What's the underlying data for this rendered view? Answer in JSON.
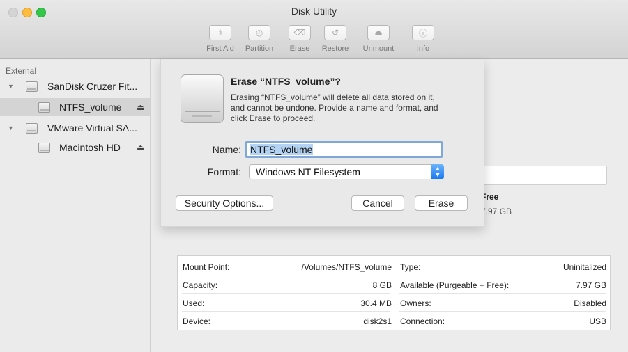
{
  "window": {
    "title": "Disk Utility"
  },
  "toolbar": [
    {
      "label": "First Aid",
      "icon": "stethoscope-icon",
      "glyph": "⚕"
    },
    {
      "label": "Partition",
      "icon": "pie-icon",
      "glyph": "◴"
    },
    {
      "label": "Erase",
      "icon": "eraser-icon",
      "glyph": "⌫"
    },
    {
      "label": "Restore",
      "icon": "restore-icon",
      "glyph": "↺"
    },
    {
      "label": "Unmount",
      "icon": "unmount-icon",
      "glyph": "⏏"
    },
    {
      "label": "Info",
      "icon": "info-icon",
      "glyph": "ⓘ"
    }
  ],
  "sidebar": {
    "section": "External",
    "items": [
      {
        "label": "SanDisk Cruzer Fit..."
      },
      {
        "label": "NTFS_volume"
      },
      {
        "label": "VMware Virtual SA..."
      },
      {
        "label": "Macintosh HD"
      }
    ],
    "eject_glyph": "⏏",
    "disclosure_glyph": "▼"
  },
  "dialog": {
    "title": "Erase “NTFS_volume”?",
    "message": "Erasing “NTFS_volume” will delete all data stored on it,\nand cannot be undone. Provide a name and format, and\nclick Erase to proceed.",
    "name_label": "Name:",
    "name_value": "NTFS_volume",
    "format_label": "Format:",
    "format_value": "Windows NT Filesystem",
    "security_button": "Security Options...",
    "cancel_button": "Cancel",
    "erase_button": "Erase"
  },
  "summary": {
    "free_label": "Free",
    "free_value": "7.97 GB"
  },
  "info": {
    "rows": [
      {
        "k1": "Mount Point:",
        "v1": "/Volumes/NTFS_volume",
        "k2": "Type:",
        "v2": "Uninitalized"
      },
      {
        "k1": "Capacity:",
        "v1": "8 GB",
        "k2": "Available (Purgeable + Free):",
        "v2": "7.97 GB"
      },
      {
        "k1": "Used:",
        "v1": "30.4 MB",
        "k2": "Owners:",
        "v2": "Disabled"
      },
      {
        "k1": "Device:",
        "v1": "disk2s1",
        "k2": "Connection:",
        "v2": "USB"
      }
    ]
  },
  "colors": {
    "accent": "#1778f2",
    "selection": "#b4d3f2",
    "sidebar_selected": "#d4d4d4"
  }
}
